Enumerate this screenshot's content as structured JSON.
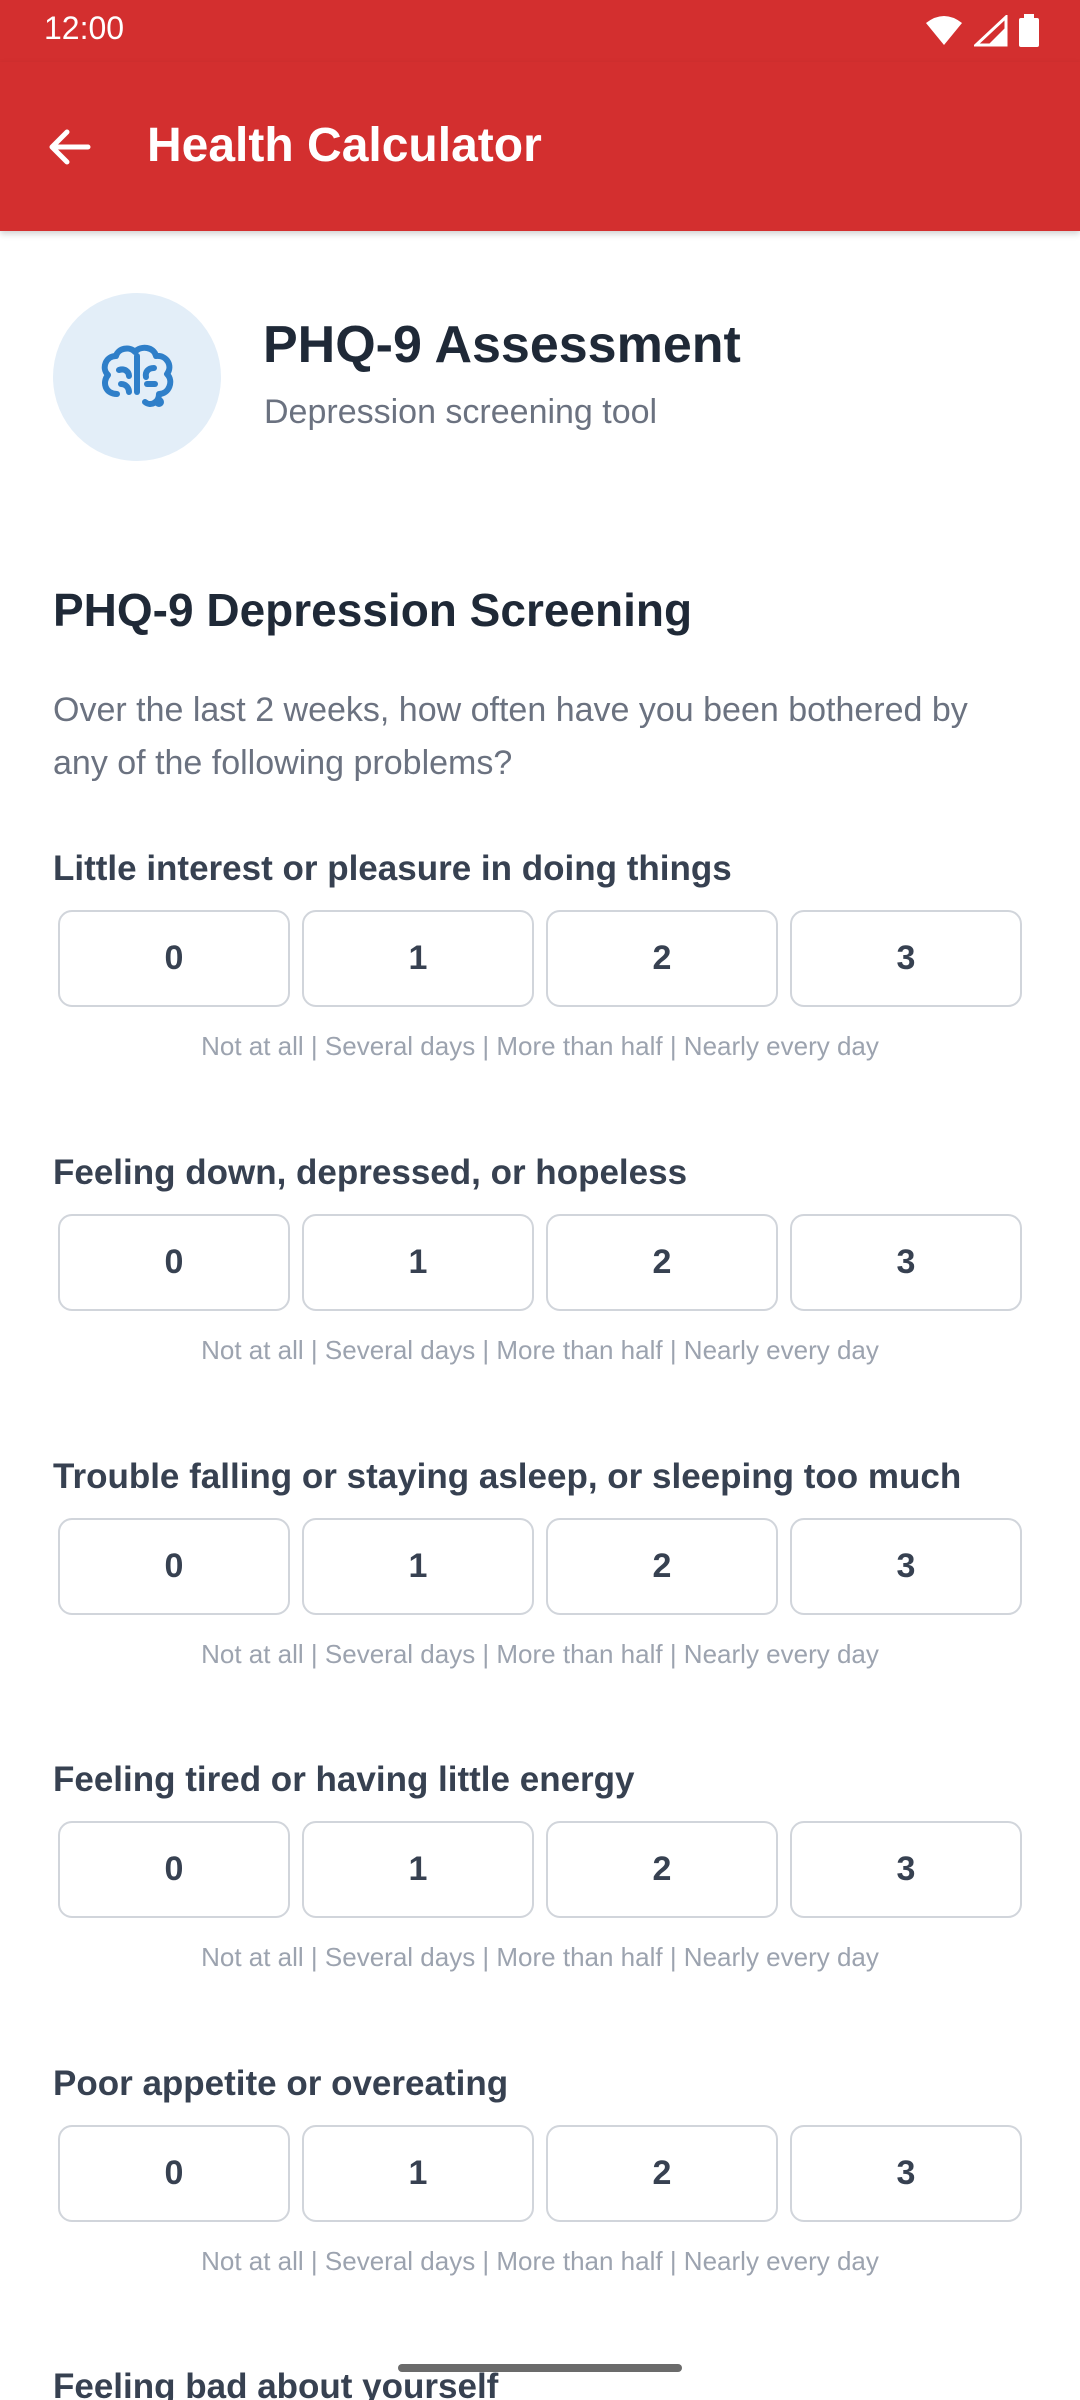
{
  "status_bar": {
    "time": "12:00"
  },
  "app_bar": {
    "title": "Health Calculator",
    "back_icon": "arrow-back-icon"
  },
  "header": {
    "icon": "brain-icon",
    "title": "PHQ-9 Assessment",
    "subtitle": "Depression screening tool"
  },
  "section": {
    "title": "PHQ-9 Depression Screening",
    "intro": "Over the last 2 weeks, how often have you been bothered by any of the following problems?"
  },
  "options": [
    "0",
    "1",
    "2",
    "3"
  ],
  "legend": "Not at all | Several days | More than half | Nearly every day",
  "questions": [
    {
      "label": "Little interest or pleasure in doing things"
    },
    {
      "label": "Feeling down, depressed, or hopeless"
    },
    {
      "label": "Trouble falling or staying asleep, or sleeping too much"
    },
    {
      "label": "Feeling tired or having little energy"
    },
    {
      "label": "Poor appetite or overeating"
    },
    {
      "label": "Feeling bad about yourself"
    }
  ],
  "colors": {
    "primary": "#d32f2f",
    "icon_bg": "#e3eef8",
    "icon": "#2f7fc9"
  }
}
